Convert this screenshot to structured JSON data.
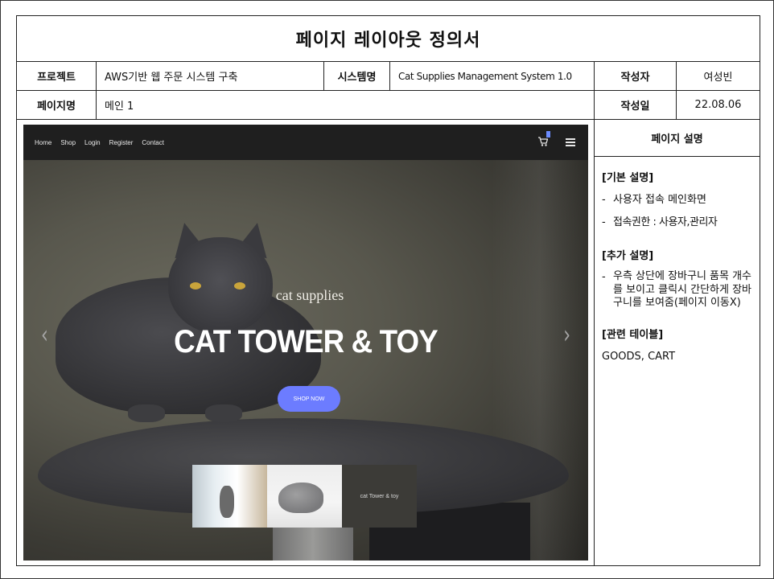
{
  "document": {
    "title": "페이지 레이아웃 정의서",
    "project_label": "프로젝트",
    "project_value": "AWS기반 웹 주문 시스템 구축",
    "system_label": "시스템명",
    "system_value": "Cat Supplies Management System 1.0",
    "author_label": "작성자",
    "author_value": "여성빈",
    "page_label": "페이지명",
    "page_value": "메인 1",
    "date_label": "작성일",
    "date_value": "22.08.06"
  },
  "screenshot": {
    "nav": [
      "Home",
      "Shop",
      "Login",
      "Register",
      "Contact"
    ],
    "hero_subtitle": "cat supplies",
    "hero_title": "CAT TOWER & TOY",
    "hero_button": "SHOP NOW",
    "thumb_caption": "cat Tower & toy",
    "accent_color": "#6c7cff"
  },
  "description": {
    "header": "페이지 설명",
    "basic_title": "[기본 설명]",
    "basic_items": [
      "사용자 접속 메인화면",
      "접속권한 : 사용자,관리자"
    ],
    "extra_title": "[추가 설명]",
    "extra_items": [
      "우측 상단에 장바구니 품목 개수를 보이고 클릭시 간단하게 장바구니를 보여줌(페이지 이동X)"
    ],
    "tables_title": "[관련 테이블]",
    "tables_value": "GOODS, CART"
  }
}
